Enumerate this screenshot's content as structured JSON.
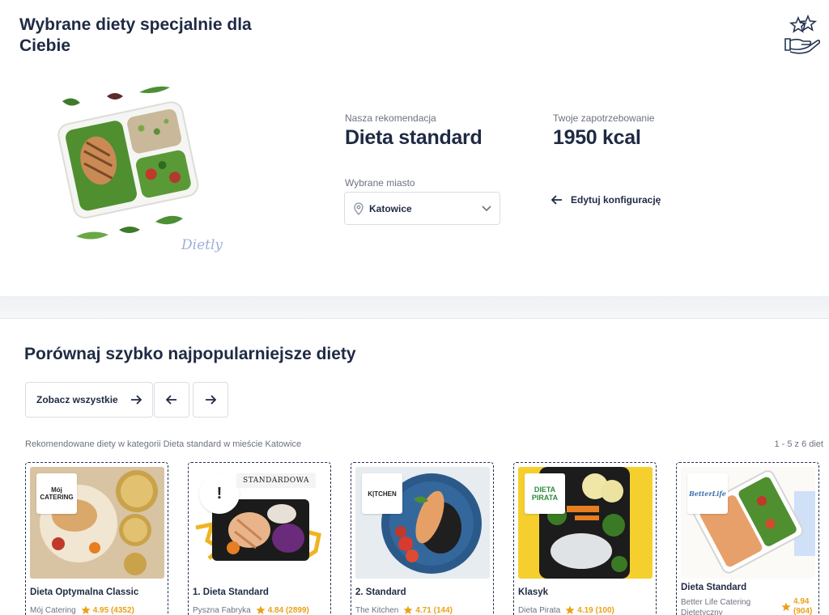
{
  "header": {
    "title": "Wybrane diety specjalnie dla Ciebie",
    "badge_icon": "stars-hand-icon"
  },
  "hero": {
    "watermark": "Dietly"
  },
  "recommendation": {
    "label": "Nasza rekomendacja",
    "value": "Dieta standard"
  },
  "needs": {
    "label": "Twoje zapotrzebowanie",
    "value": "1950 kcal"
  },
  "city": {
    "label": "Wybrane miasto",
    "value": "Katowice",
    "icon": "map-pin-icon"
  },
  "edit": {
    "label": "Edytuj konfigurację",
    "icon": "arrow-left-icon"
  },
  "compare": {
    "title": "Porównaj szybko najpopularniejsze diety",
    "see_all_label": "Zobacz wszystkie",
    "recommended_text": "Rekomendowane diety w kategorii Dieta standard w mieście Katowice",
    "count_text": "1 - 5 z 6 diet"
  },
  "cards": [
    {
      "name": "Dieta Optymalna Classic",
      "provider": "Mój Catering",
      "rating": "4.95 (4352)",
      "logo": "Mój CATERING",
      "bg": "#e9d9c2"
    },
    {
      "name": "1. Dieta Standard",
      "provider": "Pyszna Fabryka",
      "rating": "4.84 (2899)",
      "logo": "!",
      "ribbon": "STANDARDOWA",
      "bg": "#ffffff"
    },
    {
      "name": "2. Standard",
      "provider": "The Kitchen",
      "rating": "4.71 (144)",
      "logo": "K|TCHEN",
      "bg": "#e8eef2"
    },
    {
      "name": "Klasyk",
      "provider": "Dieta Pirata",
      "rating": "4.19 (100)",
      "logo": "DIETA PIRATA",
      "bg": "#f5cf2e"
    },
    {
      "name": "Dieta Standard",
      "provider": "Better Life Catering Dietetyczny",
      "rating": "4.94 (904)",
      "logo": "BetterLife",
      "bg": "#fbfaf6"
    }
  ],
  "colors": {
    "primary": "#1f2a44",
    "star": "#e8a317",
    "muted": "#6b7280"
  }
}
